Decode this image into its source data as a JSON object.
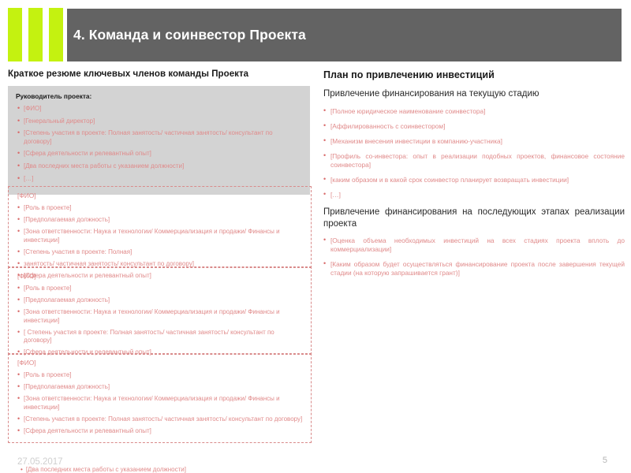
{
  "header": {
    "title": "4. Команда и соинвестор Проекта",
    "accent_color": "#c4f210",
    "band_color": "#636363",
    "bars": [
      "bar-1",
      "bar-2",
      "bar-3"
    ]
  },
  "left": {
    "heading": "Краткое резюме ключевых членов команды Проекта",
    "leader_panel": {
      "title": "Руководитель проекта:",
      "items": [
        "[ФИО]",
        "[Генеральный директор]",
        "[Степень участия в проекте: Полная занятость/ частичная занятость/ консультант по договору]",
        "[Сфера деятельности и релевантный опыт]",
        "[Два последних места работы с указанием должности]",
        "[…]"
      ]
    },
    "members": [
      {
        "name": "[ФИО]",
        "items": [
          "[Роль в проекте]",
          "[Предполагаемая должность]",
          "[Зона ответственности: Наука и технологии/ Коммерциализация и продажи/ Финансы и инвестиции]",
          "[Степень участия в проекте: Полная]",
          " занятость/ частичная занятость/ консультант по договору]",
          "[Сфера деятельности и релевантный опыт]"
        ]
      },
      {
        "name": "[ФИО]",
        "items": [
          "[Роль в проекте]",
          "[Предполагаемая должность]",
          "[Зона ответственности: Наука и технологии/ Коммерциализация и продажи/ Финансы и инвестиции]",
          "[ Степень участия в проекте: Полная занятость/ частичная занятость/ консультант по договору]",
          "[Сфера деятельности и релевантный опыт]"
        ]
      },
      {
        "name": "[ФИО]",
        "items": [
          "[Роль в проекте]",
          "[Предполагаемая должность]",
          "[Зона ответственности: Наука и технологии/ Коммерциализация и продажи/ Финансы и инвестиции]",
          "[Степень участия в проекте: Полная занятость/ частичная занятость/ консультант по договору]",
          "[Сфера деятельности и релевантный опыт]"
        ]
      }
    ],
    "overflow_item": "[Два последних места работы с указанием должности]"
  },
  "right": {
    "heading": "План по привлечению инвестиций",
    "section1": {
      "title": "Привлечение финансирования на текущую стадию",
      "items": [
        "[Полное юридическое наименование соинвестора]",
        "[Аффилированность с соинвестором]",
        "[Механизм внесения инвестиции в компанию-участника]",
        "[Профиль со-инвестора: опыт в реализации подобных проектов, финансовое состояние соинвестора]",
        "[каким образом и в какой срок соинвестор планирует возвращать инвестиции]",
        "[…]"
      ]
    },
    "section2": {
      "title": "Привлечение финансирования на последующих этапах реализации проекта",
      "items": [
        "[Оценка объема необходимых инвестиций на всех стадиях проекта вплоть до коммерциализации]",
        "[Каким образом будет осуществляться финансирование проекта после завершения текущей стадии (на которую запрашивается грант)]"
      ]
    }
  },
  "footer": {
    "date": "27.05.2017",
    "page_number": "5"
  }
}
